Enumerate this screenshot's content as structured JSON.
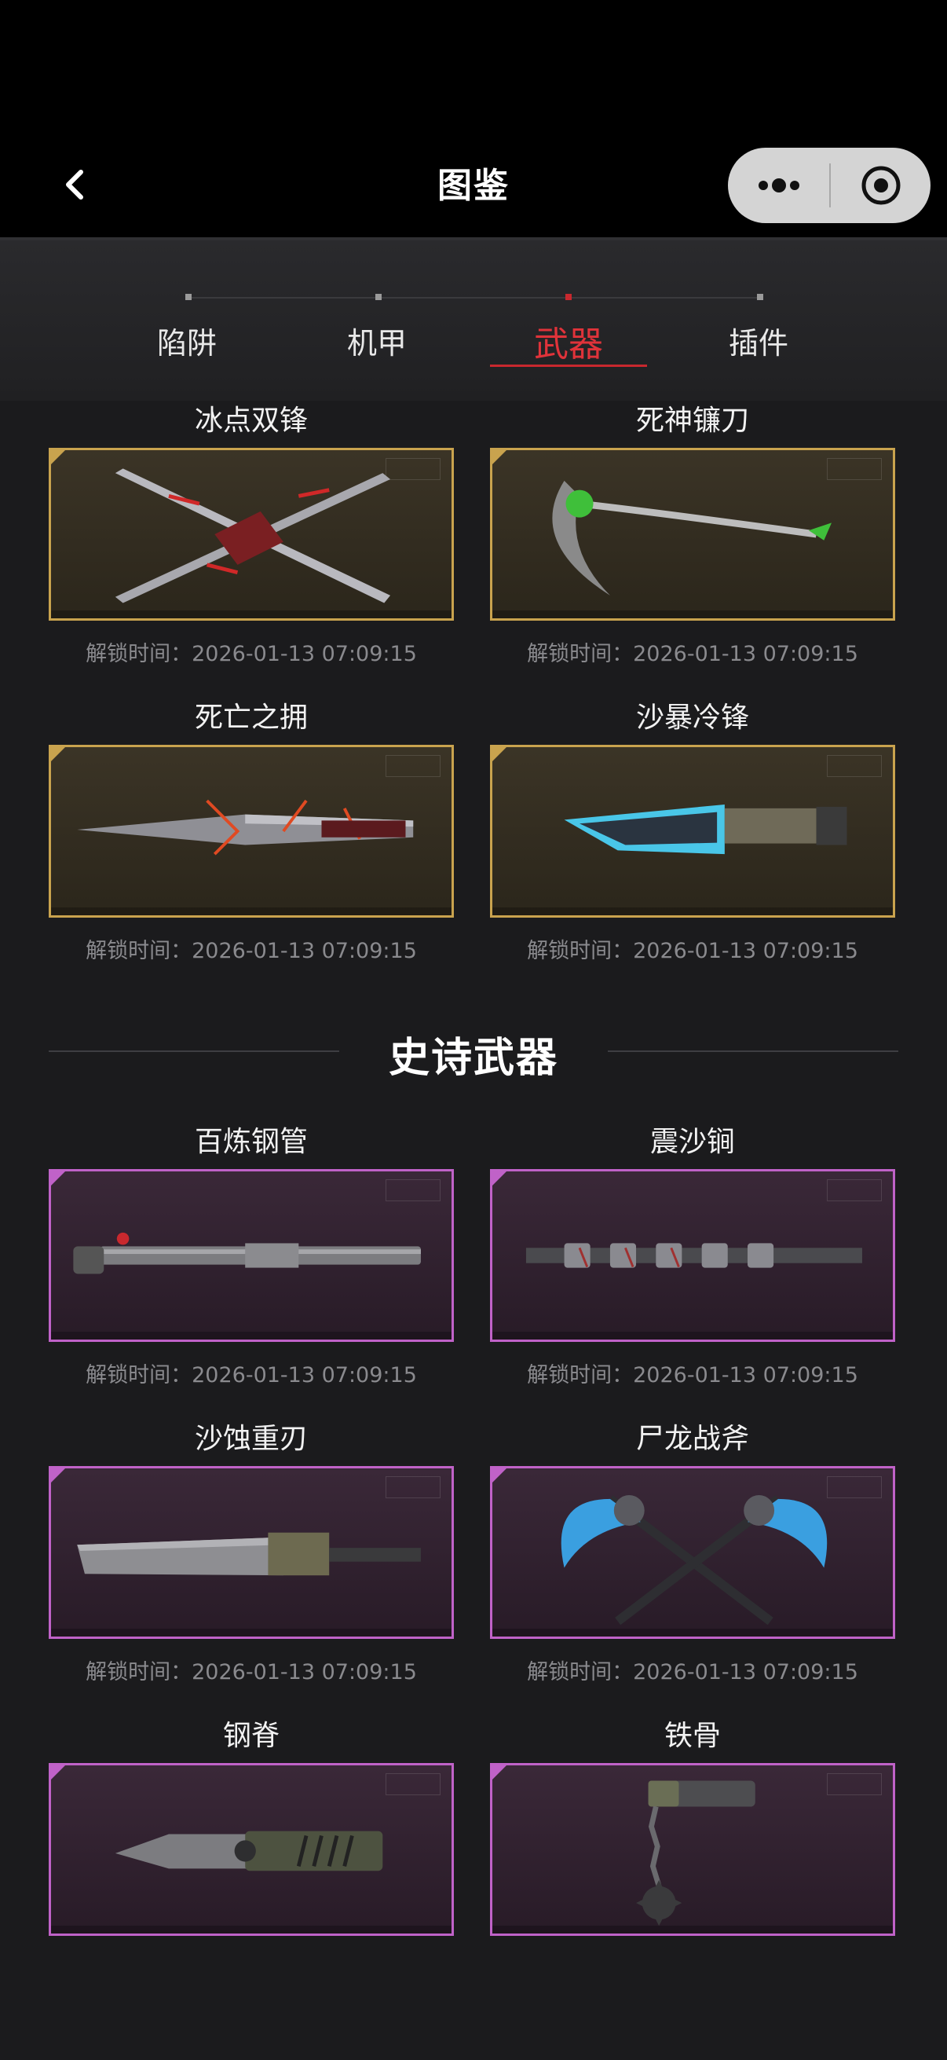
{
  "nav": {
    "title": "图鉴"
  },
  "tabs": [
    {
      "label": "陷阱",
      "active": false
    },
    {
      "label": "机甲",
      "active": false
    },
    {
      "label": "武器",
      "active": true
    },
    {
      "label": "插件",
      "active": false
    }
  ],
  "legendary": [
    {
      "name": "冰点双锋",
      "unlock_label": "解锁时间：",
      "unlock_time": "2026-01-13 07:09:15"
    },
    {
      "name": "死神镰刀",
      "unlock_label": "解锁时间：",
      "unlock_time": "2026-01-13 07:09:15"
    },
    {
      "name": "死亡之拥",
      "unlock_label": "解锁时间：",
      "unlock_time": "2026-01-13 07:09:15"
    },
    {
      "name": "沙暴冷锋",
      "unlock_label": "解锁时间：",
      "unlock_time": "2026-01-13 07:09:15"
    }
  ],
  "epic_section": {
    "title": "史诗武器"
  },
  "epic": [
    {
      "name": "百炼钢管",
      "unlock_label": "解锁时间：",
      "unlock_time": "2026-01-13 07:09:15"
    },
    {
      "name": "震沙锏",
      "unlock_label": "解锁时间：",
      "unlock_time": "2026-01-13 07:09:15"
    },
    {
      "name": "沙蚀重刃",
      "unlock_label": "解锁时间：",
      "unlock_time": "2026-01-13 07:09:15"
    },
    {
      "name": "尸龙战斧",
      "unlock_label": "解锁时间：",
      "unlock_time": "2026-01-13 07:09:15"
    },
    {
      "name": "钢脊",
      "unlock_label": "",
      "unlock_time": ""
    },
    {
      "name": "铁骨",
      "unlock_label": "",
      "unlock_time": ""
    }
  ],
  "colors": {
    "active_tab": "#e0333a",
    "legendary_frame": "#c9a34e",
    "epic_frame": "#c062c8"
  },
  "icons": {
    "back": "chevron-left-icon",
    "more": "more-dots-icon",
    "close": "target-close-icon"
  }
}
